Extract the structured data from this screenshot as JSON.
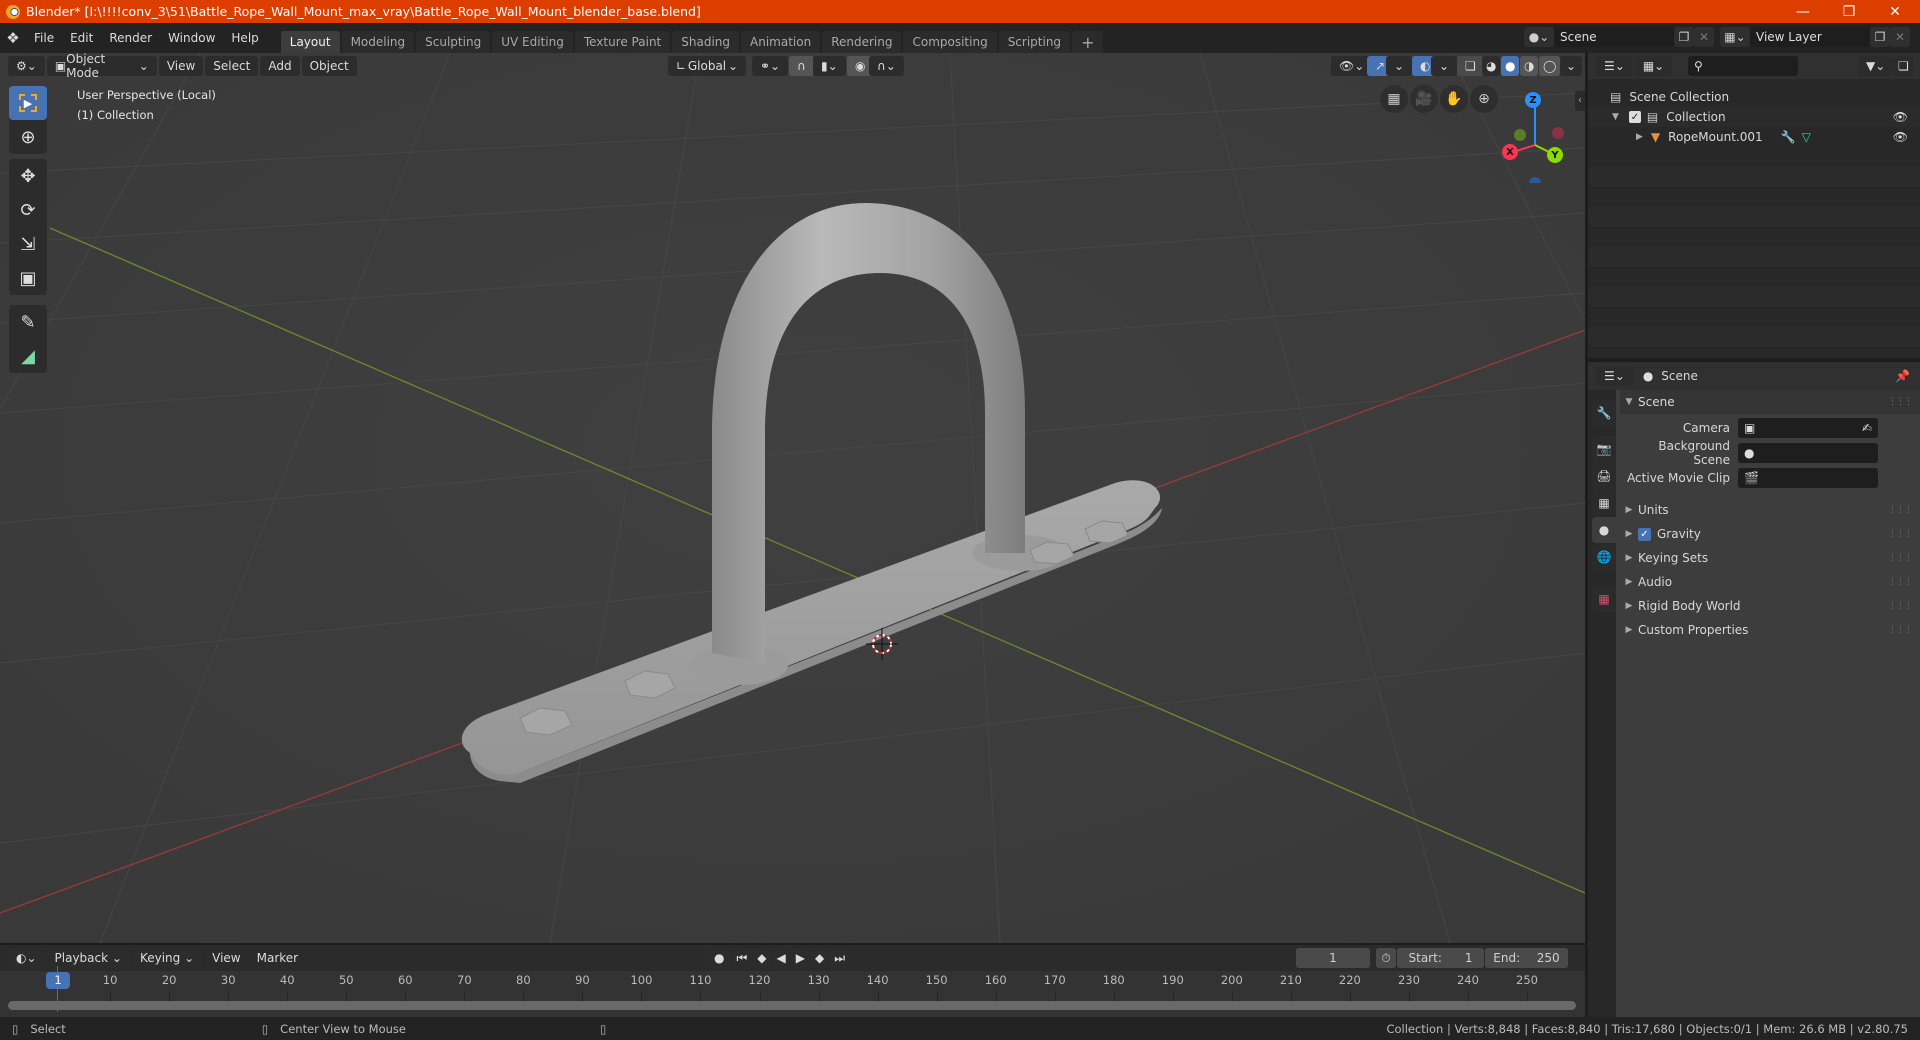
{
  "window": {
    "title": "Blender* [I:\\!!!!conv_3\\51\\Battle_Rope_Wall_Mount_max_vray\\Battle_Rope_Wall_Mount_blender_base.blend]",
    "controls": [
      "minimize",
      "maximize",
      "close"
    ]
  },
  "menubar": {
    "items": [
      "File",
      "Edit",
      "Render",
      "Window",
      "Help"
    ]
  },
  "workspaces": {
    "tabs": [
      "Layout",
      "Modeling",
      "Sculpting",
      "UV Editing",
      "Texture Paint",
      "Shading",
      "Animation",
      "Rendering",
      "Compositing",
      "Scripting"
    ],
    "active": "Layout",
    "add_label": "+"
  },
  "scene_selector": {
    "value": "Scene"
  },
  "view_layer_selector": {
    "value": "View Layer"
  },
  "viewport": {
    "mode": "Object Mode",
    "menus": [
      "View",
      "Select",
      "Add",
      "Object"
    ],
    "orientation": "Global",
    "overlay_text": {
      "line1": "User Perspective (Local)",
      "line2": "(1) Collection"
    },
    "gizmo_axes": {
      "x": "X",
      "y": "Y",
      "z": "Z"
    },
    "axis_colors": {
      "x": "#ff3352",
      "y": "#8bdc00",
      "z": "#2890ff"
    },
    "object_name": "RopeMount.001"
  },
  "toolbar": {
    "tools": [
      "select-box",
      "cursor",
      "move",
      "rotate",
      "scale",
      "transform",
      "annotate",
      "measure"
    ],
    "active": "select-box"
  },
  "outliner": {
    "root": "Scene Collection",
    "items": [
      {
        "name": "Collection",
        "checked": true,
        "visible": true
      },
      {
        "name": "RopeMount.001",
        "visible": true
      }
    ]
  },
  "properties": {
    "context": "Scene",
    "panel_title": "Scene",
    "fields": [
      {
        "label": "Camera",
        "value": ""
      },
      {
        "label": "Background Scene",
        "value": ""
      },
      {
        "label": "Active Movie Clip",
        "value": ""
      }
    ],
    "sections": [
      {
        "label": "Units"
      },
      {
        "label": "Gravity",
        "checkbox": true
      },
      {
        "label": "Keying Sets"
      },
      {
        "label": "Audio"
      },
      {
        "label": "Rigid Body World"
      },
      {
        "label": "Custom Properties"
      }
    ]
  },
  "timeline": {
    "menus": [
      "Playback",
      "Keying",
      "View",
      "Marker"
    ],
    "current_frame": "1",
    "start_label": "Start:",
    "start": "1",
    "end_label": "End:",
    "end": "250",
    "ticks": [
      "10",
      "20",
      "30",
      "40",
      "50",
      "60",
      "70",
      "80",
      "90",
      "100",
      "110",
      "120",
      "130",
      "140",
      "150",
      "160",
      "170",
      "180",
      "190",
      "200",
      "210",
      "220",
      "230",
      "240",
      "250"
    ],
    "playhead": "1"
  },
  "statusbar": {
    "left_hint": "Select",
    "middle_hint": "Center View to Mouse",
    "stats": "Collection | Verts:8,848 | Faces:8,840 | Tris:17,680 | Objects:0/1 | Mem: 26.6 MB | v2.80.75"
  }
}
